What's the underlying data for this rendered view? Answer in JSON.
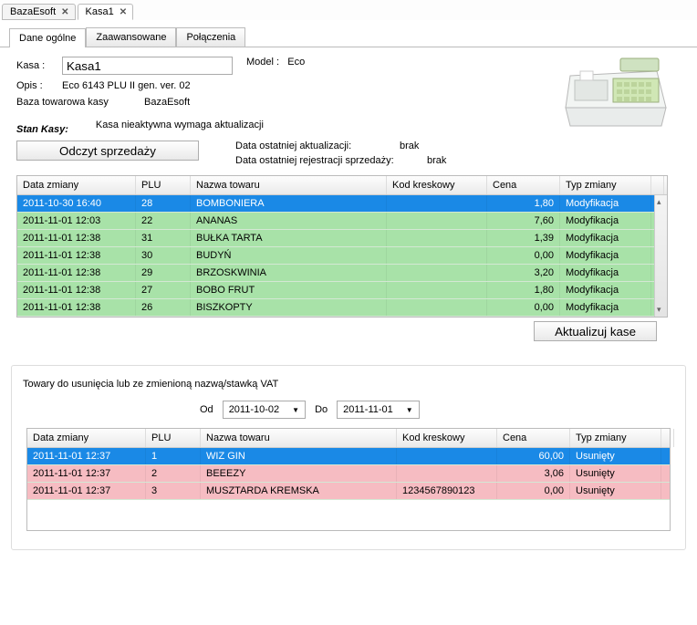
{
  "docTabs": [
    {
      "label": "BazaEsoft",
      "active": false
    },
    {
      "label": "Kasa1",
      "active": true
    }
  ],
  "sectionTabs": [
    {
      "label": "Dane ogólne",
      "active": true
    },
    {
      "label": "Zaawansowane",
      "active": false
    },
    {
      "label": "Połączenia",
      "active": false
    }
  ],
  "labels": {
    "kasa": "Kasa :",
    "opis": "Opis :",
    "baza": "Baza towarowa kasy",
    "model": "Model :",
    "stan": "Stan Kasy:",
    "odczyt": "Odczyt sprzedaży",
    "dataAkt": "Data ostatniej  aktualizacji:",
    "dataRej": "Data ostatniej rejestracji sprzedaży:",
    "brak": "brak",
    "aktualizuj": "Aktualizuj kase",
    "subhead": "Towary do usunięcia lub ze zmienioną nazwą/stawką VAT",
    "od": "Od",
    "do": "Do"
  },
  "values": {
    "kasa": "Kasa1",
    "opis": "Eco 6143 PLU II gen. ver. 02",
    "baza": "BazaEsoft",
    "model": "Eco",
    "stan": "Kasa nieaktywna wymaga aktualizacji",
    "od": "2011-10-02",
    "do": "2011-11-01"
  },
  "gridCols": {
    "data": "Data zmiany",
    "plu": "PLU",
    "nazwa": "Nazwa towaru",
    "kod": "Kod kreskowy",
    "cena": "Cena",
    "typ": "Typ zmiany"
  },
  "grid1": [
    {
      "data": "2011-10-30 16:40",
      "plu": "28",
      "nazwa": "BOMBONIERA",
      "kod": "",
      "cena": "1,80",
      "typ": "Modyfikacja",
      "sel": true
    },
    {
      "data": "2011-11-01 12:03",
      "plu": "22",
      "nazwa": "ANANAS",
      "kod": "",
      "cena": "7,60",
      "typ": "Modyfikacja"
    },
    {
      "data": "2011-11-01 12:38",
      "plu": "31",
      "nazwa": "BUŁKA TARTA",
      "kod": "",
      "cena": "1,39",
      "typ": "Modyfikacja"
    },
    {
      "data": "2011-11-01 12:38",
      "plu": "30",
      "nazwa": "BUDYŃ",
      "kod": "",
      "cena": "0,00",
      "typ": "Modyfikacja"
    },
    {
      "data": "2011-11-01 12:38",
      "plu": "29",
      "nazwa": "BRZOSKWINIA",
      "kod": "",
      "cena": "3,20",
      "typ": "Modyfikacja"
    },
    {
      "data": "2011-11-01 12:38",
      "plu": "27",
      "nazwa": "BOBO FRUT",
      "kod": "",
      "cena": "1,80",
      "typ": "Modyfikacja"
    },
    {
      "data": "2011-11-01 12:38",
      "plu": "26",
      "nazwa": "BISZKOPTY",
      "kod": "",
      "cena": "0,00",
      "typ": "Modyfikacja"
    }
  ],
  "grid2": [
    {
      "data": "2011-11-01 12:37",
      "plu": "1",
      "nazwa": "WIZ GIN",
      "kod": "",
      "cena": "60,00",
      "typ": "Usunięty",
      "sel": true
    },
    {
      "data": "2011-11-01 12:37",
      "plu": "2",
      "nazwa": "BEEEZY",
      "kod": "",
      "cena": "3,06",
      "typ": "Usunięty"
    },
    {
      "data": "2011-11-01 12:37",
      "plu": "3",
      "nazwa": "MUSZTARDA KREMSKA",
      "kod": "1234567890123",
      "cena": "0,00",
      "typ": "Usunięty"
    }
  ]
}
